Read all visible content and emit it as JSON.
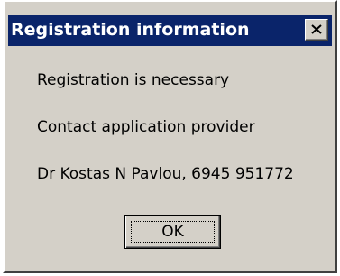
{
  "window": {
    "title": "Registration information",
    "close_icon": "close-x-icon"
  },
  "messages": {
    "line1": "Registration is necessary",
    "line2": "Contact application provider",
    "line3": "Dr Kostas N Pavlou, 6945 951772"
  },
  "buttons": {
    "ok_label": "OK"
  },
  "colors": {
    "titlebar": "#0a246a",
    "face": "#d4d0c8"
  }
}
